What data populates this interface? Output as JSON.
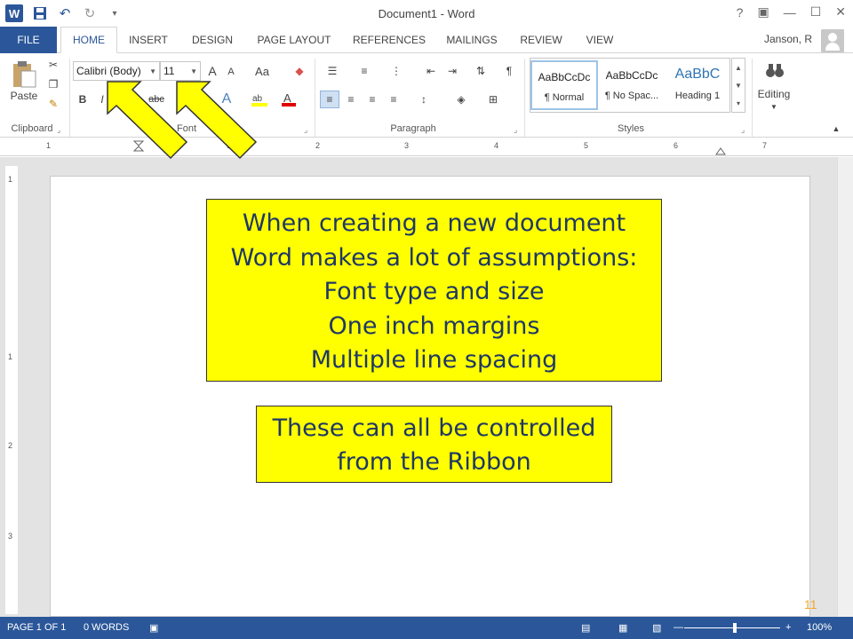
{
  "title_bar": {
    "document_title": "Document1 - Word",
    "qat_icons": [
      "word-logo-icon",
      "save-icon",
      "undo-icon",
      "redo-icon",
      "customize-qat-icon"
    ],
    "window_controls": [
      "?",
      "restore",
      "minimize",
      "maximize",
      "close"
    ]
  },
  "tabs": {
    "file": "FILE",
    "items": [
      "HOME",
      "INSERT",
      "DESIGN",
      "PAGE LAYOUT",
      "REFERENCES",
      "MAILINGS",
      "REVIEW",
      "VIEW"
    ],
    "active": "HOME",
    "user": "Janson, R"
  },
  "ribbon": {
    "clipboard": {
      "label": "Clipboard",
      "paste": "Paste"
    },
    "font": {
      "label": "Font",
      "font_name": "Calibri (Body)",
      "font_size": "11",
      "bold": "B",
      "italic": "I",
      "strikethrough": "abc",
      "grow": "A",
      "shrink": "A",
      "case": "Aa"
    },
    "paragraph": {
      "label": "Paragraph"
    },
    "styles": {
      "label": "Styles",
      "items": [
        {
          "sample": "AaBbCcDc",
          "name": "¶ Normal"
        },
        {
          "sample": "AaBbCcDc",
          "name": "¶ No Spac..."
        },
        {
          "sample": "AaBbC",
          "name": "Heading 1"
        }
      ]
    },
    "editing": {
      "label": "Editing"
    }
  },
  "ruler": {
    "numbers": [
      "1",
      "1",
      "2",
      "3",
      "4",
      "5",
      "6",
      "7"
    ]
  },
  "vertical_ruler": {
    "numbers": [
      "1",
      "1",
      "2",
      "3"
    ]
  },
  "callouts": {
    "main_lines": [
      "When creating a new document",
      "Word makes a lot of assumptions:",
      "Font type and size",
      "One inch margins",
      "Multiple line spacing"
    ],
    "secondary_lines": [
      "These can all be controlled",
      "from the Ribbon"
    ]
  },
  "status_bar": {
    "page": "PAGE 1 OF 1",
    "words": "0 WORDS",
    "zoom": "100%",
    "zoom_level_percent": 100
  },
  "slide_number": "11",
  "colors": {
    "brand": "#2b579a",
    "callout_bg": "#ffff00",
    "callout_text": "#1f3864",
    "arrow_fill": "#ffff00",
    "slide_number": "#f5a623"
  }
}
